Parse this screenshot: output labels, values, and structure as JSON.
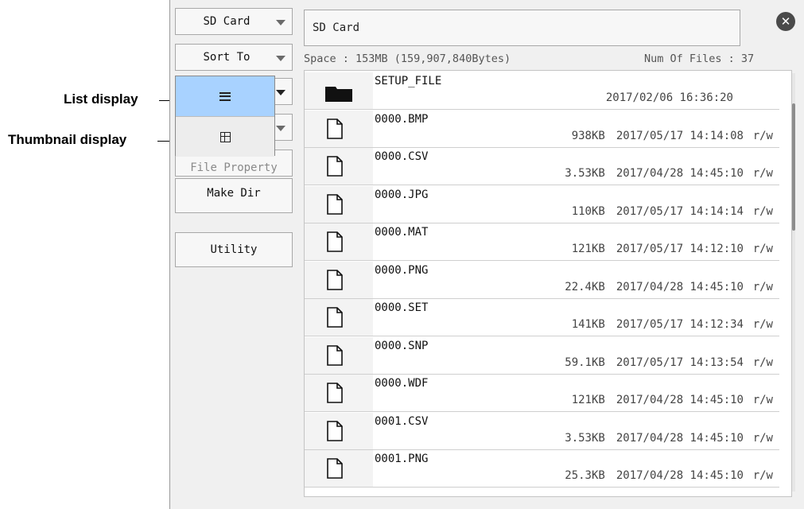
{
  "annotations": {
    "list_display": "List display",
    "thumbnail_display": "Thumbnail display"
  },
  "left_panel": {
    "drive_button": "SD Card",
    "sort_button": "Sort To",
    "file_property_button": "File Property",
    "make_dir_button": "Make Dir",
    "utility_button": "Utility"
  },
  "view_menu": {
    "options": [
      {
        "icon": "list-icon",
        "selected": true
      },
      {
        "icon": "thumbnail-grid-icon",
        "selected": false
      }
    ]
  },
  "header": {
    "path": "SD Card",
    "space": "Space : 153MB (159,907,840Bytes)",
    "num_files": "Num Of Files : 37"
  },
  "files": [
    {
      "name": "SETUP_FILE",
      "size": "",
      "date": "2017/02/06 16:36:20",
      "perm": "",
      "type": "folder"
    },
    {
      "name": "0000.BMP",
      "size": "938KB",
      "date": "2017/05/17 14:14:08",
      "perm": "r/w",
      "type": "file"
    },
    {
      "name": "0000.CSV",
      "size": "3.53KB",
      "date": "2017/04/28 14:45:10",
      "perm": "r/w",
      "type": "file"
    },
    {
      "name": "0000.JPG",
      "size": "110KB",
      "date": "2017/05/17 14:14:14",
      "perm": "r/w",
      "type": "file"
    },
    {
      "name": "0000.MAT",
      "size": "121KB",
      "date": "2017/05/17 14:12:10",
      "perm": "r/w",
      "type": "file"
    },
    {
      "name": "0000.PNG",
      "size": "22.4KB",
      "date": "2017/04/28 14:45:10",
      "perm": "r/w",
      "type": "file"
    },
    {
      "name": "0000.SET",
      "size": "141KB",
      "date": "2017/05/17 14:12:34",
      "perm": "r/w",
      "type": "file"
    },
    {
      "name": "0000.SNP",
      "size": "59.1KB",
      "date": "2017/05/17 14:13:54",
      "perm": "r/w",
      "type": "file"
    },
    {
      "name": "0000.WDF",
      "size": "121KB",
      "date": "2017/04/28 14:45:10",
      "perm": "r/w",
      "type": "file"
    },
    {
      "name": "0001.CSV",
      "size": "3.53KB",
      "date": "2017/04/28 14:45:10",
      "perm": "r/w",
      "type": "file"
    },
    {
      "name": "0001.PNG",
      "size": "25.3KB",
      "date": "2017/04/28 14:45:10",
      "perm": "r/w",
      "type": "file"
    }
  ],
  "colors": {
    "selected_option": "#a8d2ff",
    "panel_bg": "#f0f0f0"
  }
}
